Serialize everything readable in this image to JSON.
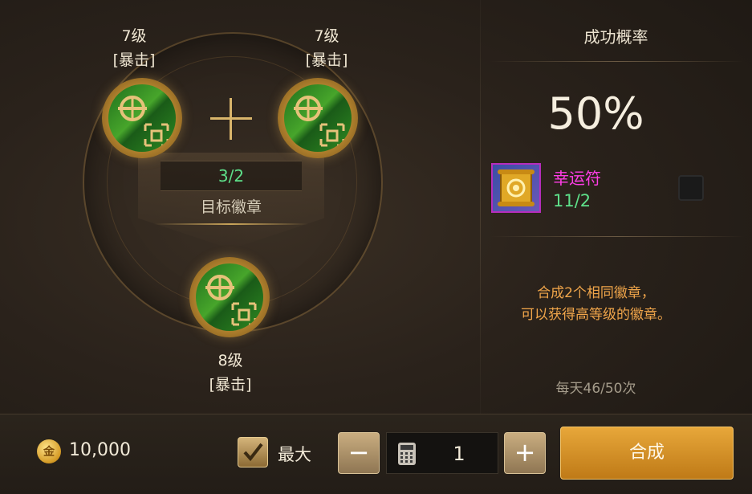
{
  "left": {
    "source_badge_1": {
      "level": "7级",
      "type": "[暴击]"
    },
    "source_badge_2": {
      "level": "7级",
      "type": "[暴击]"
    },
    "result_badge": {
      "level": "8级",
      "type": "[暴击]"
    },
    "badge_count": "3/2",
    "target_label": "目标徽章"
  },
  "right": {
    "title": "成功概率",
    "success_rate": "50%",
    "luck_charm": {
      "name": "幸运符",
      "count": "11/2",
      "checked": false
    },
    "description_line1": "合成2个相同徽章，",
    "description_line2": "可以获得高等级的徽章。",
    "daily_limit": "每天46/50次"
  },
  "bottom": {
    "gold": "10,000",
    "coin_glyph": "金",
    "max_label": "最大",
    "max_checked": true,
    "decrease_label": "−",
    "quantity": "1",
    "increase_label": "+",
    "synthesize_label": "合成"
  },
  "colors": {
    "success_green": "#5ee08a",
    "charm_magenta": "#ff3de6",
    "description_orange": "#f0a54a",
    "button_gold": "#d8901f"
  }
}
